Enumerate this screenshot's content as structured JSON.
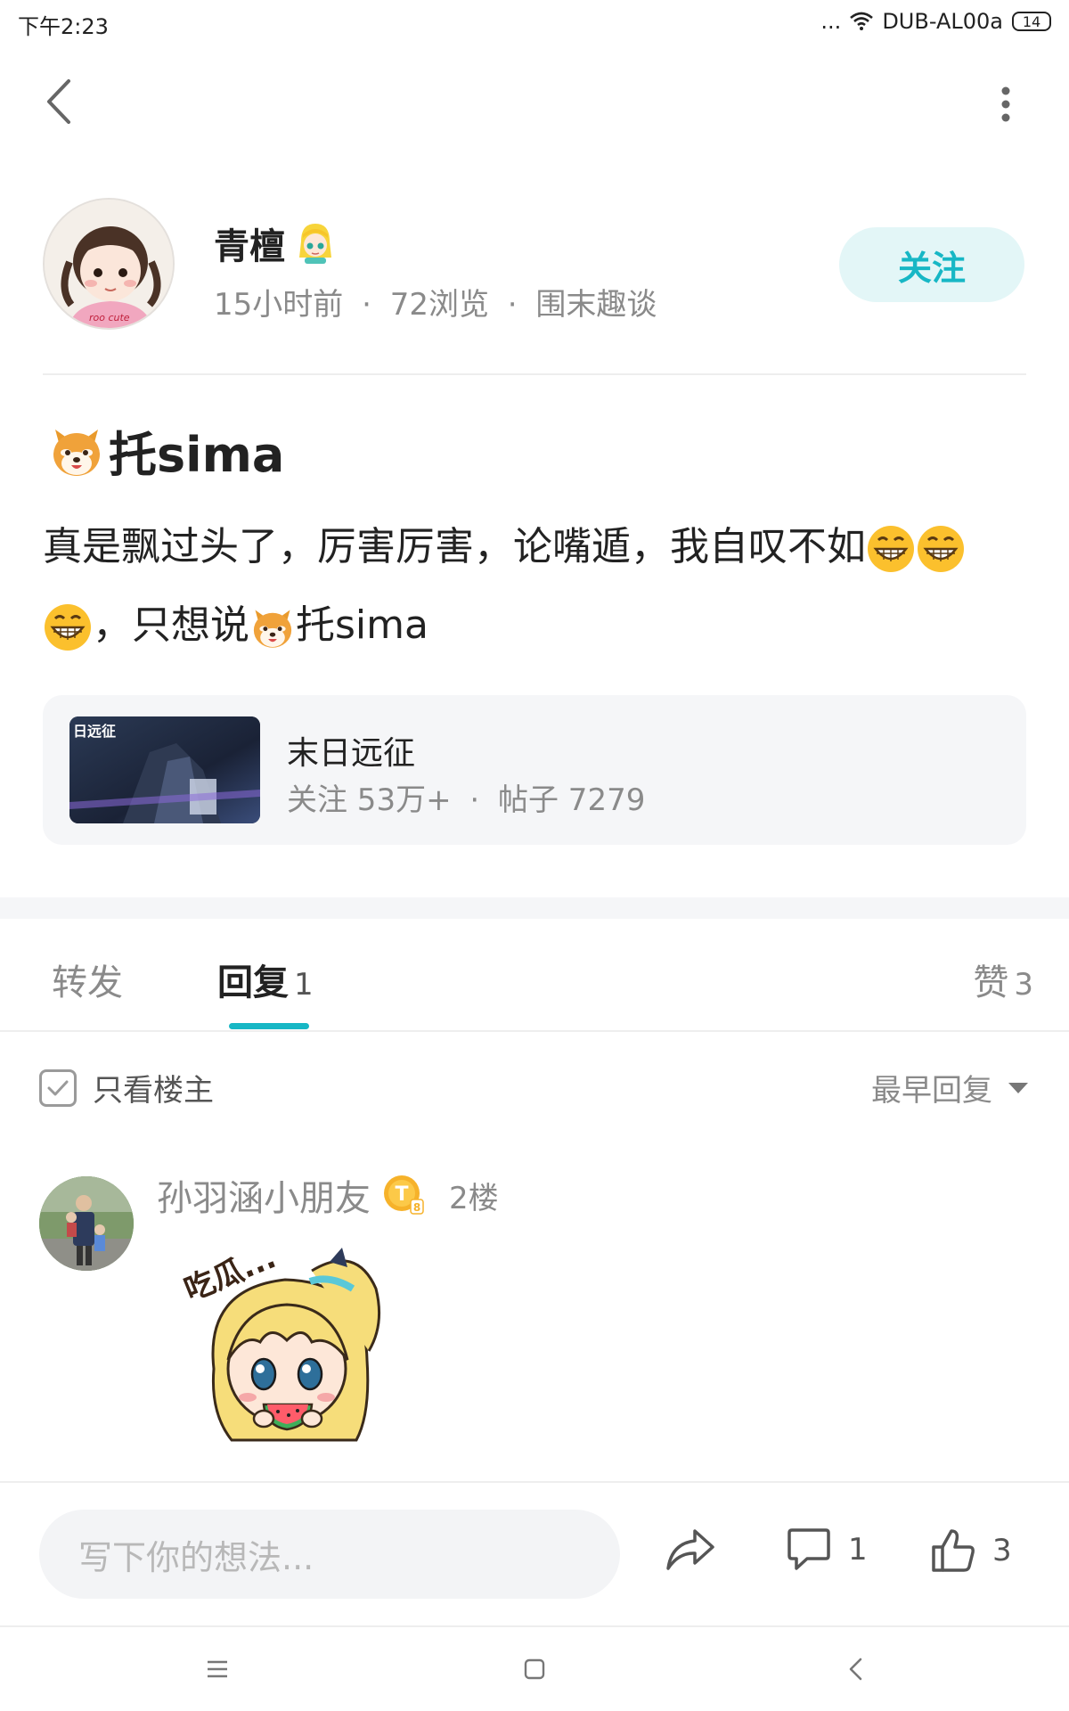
{
  "status_bar": {
    "time": "下午2:23",
    "dots": "...",
    "network": "DUB-AL00a",
    "battery": "14"
  },
  "nav": {
    "back_icon": "chevron-left-icon",
    "more_icon": "more-vertical-icon"
  },
  "author": {
    "name": "青檀",
    "time_ago": "15小时前",
    "views": "72浏览",
    "forum": "围末趣谈",
    "sep": "·",
    "follow_label": "关注"
  },
  "post": {
    "title": "托sima",
    "body_part1": "真是飘过头了，厉害厉害，论嘴遁，我自叹不如",
    "body_part2": "，只想说",
    "body_part3": "托sima"
  },
  "forum_card": {
    "name": "末日远征",
    "followers": "关注 53万+",
    "sep": "·",
    "posts": "帖子 7279",
    "thumb_caption": "日远征"
  },
  "tabs": {
    "forward": "转发",
    "reply": "回复",
    "reply_count": "1",
    "like": "赞",
    "like_count": "3"
  },
  "filter": {
    "only_host": "只看楼主",
    "sort": "最早回复"
  },
  "reply": {
    "username": "孙羽涵小朋友",
    "badge": "T",
    "badge_level": "8",
    "floor": "2楼",
    "sticker_text": "吃瓜..."
  },
  "bottom_bar": {
    "placeholder": "写下你的想法...",
    "comment_count": "1",
    "like_count": "3"
  },
  "colors": {
    "accent": "#17b7c5",
    "follow_bg": "#e3f6f7",
    "muted": "#8a8a8a"
  }
}
